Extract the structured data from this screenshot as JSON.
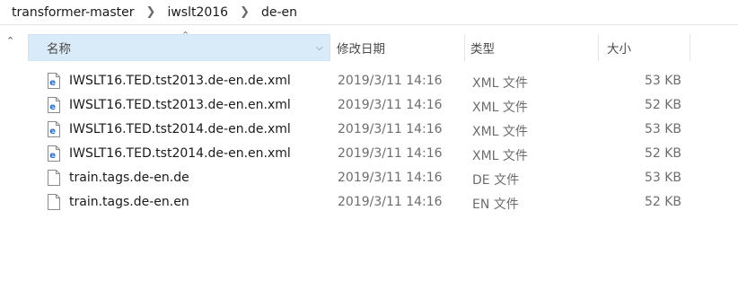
{
  "breadcrumb": [
    "transformer-master",
    "iwslt2016",
    "de-en"
  ],
  "columns": {
    "name": "名称",
    "date": "修改日期",
    "type": "类型",
    "size": "大小"
  },
  "files": [
    {
      "name": "IWSLT16.TED.tst2013.de-en.de.xml",
      "date": "2019/3/11 14:16",
      "type": "XML 文件",
      "size": "53 KB",
      "icon": "edge-xml-file-icon"
    },
    {
      "name": "IWSLT16.TED.tst2013.de-en.en.xml",
      "date": "2019/3/11 14:16",
      "type": "XML 文件",
      "size": "52 KB",
      "icon": "edge-xml-file-icon"
    },
    {
      "name": "IWSLT16.TED.tst2014.de-en.de.xml",
      "date": "2019/3/11 14:16",
      "type": "XML 文件",
      "size": "53 KB",
      "icon": "edge-xml-file-icon"
    },
    {
      "name": "IWSLT16.TED.tst2014.de-en.en.xml",
      "date": "2019/3/11 14:16",
      "type": "XML 文件",
      "size": "52 KB",
      "icon": "edge-xml-file-icon"
    },
    {
      "name": "train.tags.de-en.de",
      "date": "2019/3/11 14:16",
      "type": "DE 文件",
      "size": "53 KB",
      "icon": "blank-file-icon"
    },
    {
      "name": "train.tags.de-en.en",
      "date": "2019/3/11 14:16",
      "type": "EN 文件",
      "size": "52 KB",
      "icon": "blank-file-icon"
    }
  ],
  "colors": {
    "selected_header": "#d9ebf9",
    "edge_blue": "#1f6fd1"
  }
}
